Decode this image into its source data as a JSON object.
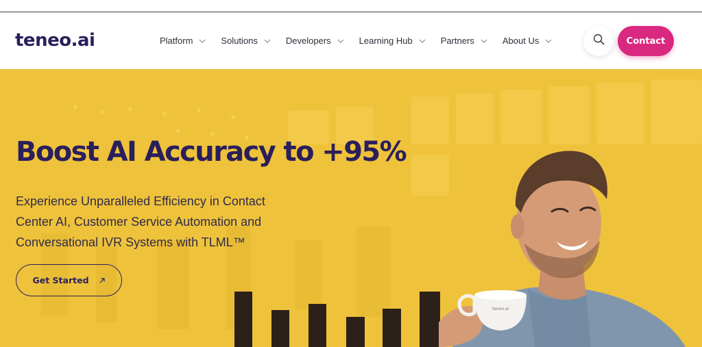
{
  "brand": {
    "logo_text": "teneo.ai"
  },
  "nav": {
    "items": [
      {
        "label": "Platform"
      },
      {
        "label": "Solutions"
      },
      {
        "label": "Developers"
      },
      {
        "label": "Learning Hub"
      },
      {
        "label": "Partners"
      },
      {
        "label": "About Us"
      }
    ]
  },
  "header_actions": {
    "search_icon": "search-icon",
    "contact_label": "Contact"
  },
  "hero": {
    "headline": "Boost AI Accuracy to +95%",
    "subtext": "Experience Unparalleled Efficiency in Contact Center AI, Customer Service Automation and Conversational IVR Systems with TLML™",
    "cta_label": "Get Started",
    "cta_icon": "arrow-up-right-icon",
    "cup_text": "teneo.ai"
  },
  "colors": {
    "brand_navy": "#2a1f5c",
    "accent_pink": "#d9287f",
    "hero_yellow": "#efc23b"
  }
}
